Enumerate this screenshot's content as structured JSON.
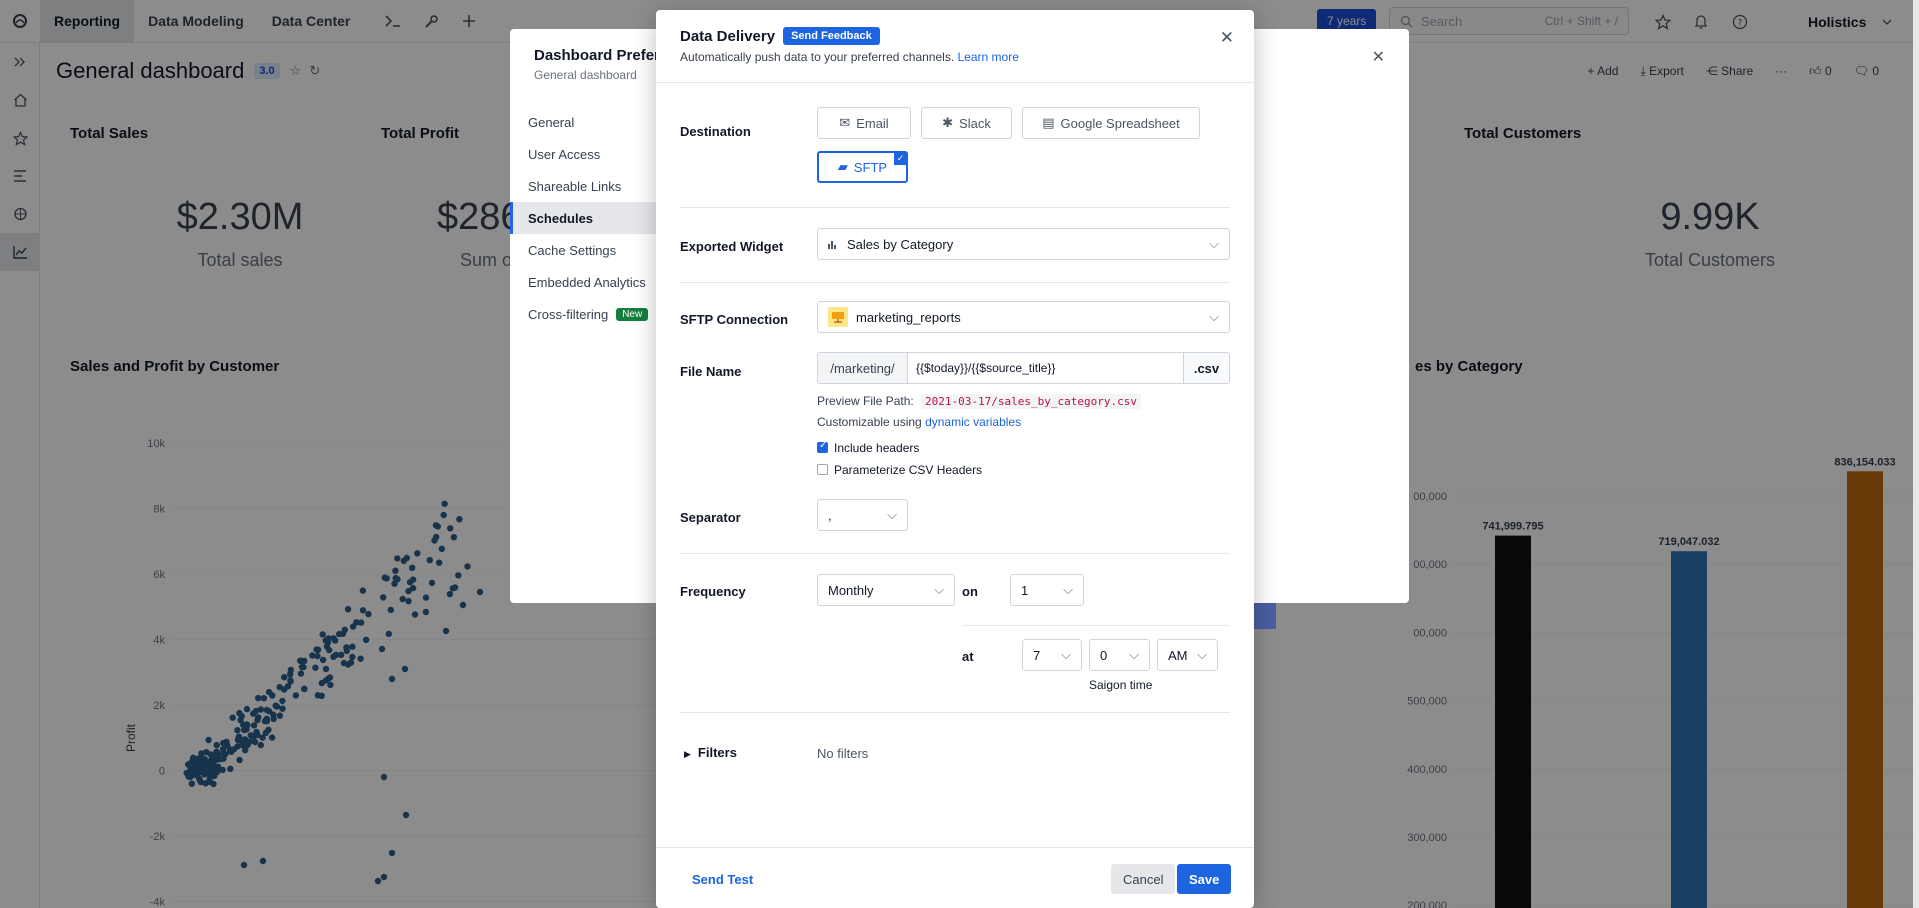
{
  "topbar": {
    "tabs": [
      "Reporting",
      "Data Modeling",
      "Data Center"
    ],
    "range": "7 years",
    "search_placeholder": "Search",
    "search_shortcut": "Ctrl + Shift + /",
    "brand": "Holistics"
  },
  "dashboard": {
    "title": "General dashboard",
    "version": "3.0",
    "actions": {
      "add": "Add",
      "export": "Export",
      "share": "Share",
      "likes": "0",
      "comments": "0"
    },
    "kpis": [
      {
        "title": "Total Sales",
        "value": "$2.30M",
        "sub": "Total sales"
      },
      {
        "title": "Total Profit",
        "value": "$286",
        "sub": "Sum o"
      },
      {
        "title": "Total Customers",
        "value": "9.99K",
        "sub": "Total Customers"
      }
    ],
    "scatter": {
      "title": "Sales and Profit by Customer",
      "ylabel": "Profit",
      "yticks": [
        "10k",
        "8k",
        "6k",
        "4k",
        "2k",
        "0",
        "-2k",
        "-4k"
      ]
    },
    "bars": {
      "title": "es by Category",
      "yticks": [
        "00,000",
        "00,000",
        "00,000",
        "500,000",
        "400,000",
        "300,000",
        "200,000"
      ],
      "labels": [
        "741,999.795",
        "719,047.032",
        "836,154.033"
      ]
    }
  },
  "chart_data": {
    "type": "bar",
    "title": "es by Category",
    "categories": [
      "",
      "",
      ""
    ],
    "values": [
      741999.795,
      719047.032,
      836154.033
    ],
    "ylim": [
      100000,
      900000
    ],
    "colors": [
      "#111111",
      "#2f74b5",
      "#c06a10"
    ]
  },
  "preferences": {
    "title": "Dashboard Prefere",
    "subtitle": "General dashboard",
    "items": [
      "General",
      "User Access",
      "Shareable Links",
      "Schedules",
      "Cache Settings",
      "Embedded Analytics",
      "Cross-filtering"
    ],
    "active_index": 3,
    "new_tag": "New"
  },
  "modal": {
    "title": "Data Delivery",
    "feedback": "Send Feedback",
    "subtitle": "Automatically push data to your preferred channels.",
    "learn_more": "Learn more",
    "destination_label": "Destination",
    "destinations": [
      "Email",
      "Slack",
      "Google Spreadsheet",
      "SFTP"
    ],
    "exported_widget_label": "Exported Widget",
    "exported_widget": "Sales by Category",
    "sftp_label": "SFTP Connection",
    "sftp_connection": "marketing_reports",
    "filename_label": "File Name",
    "filename_prefix": "/marketing/",
    "filename_value": "{{$today}}/{{$source_title}}",
    "filename_ext": ".csv",
    "preview_label": "Preview File Path:",
    "preview_path": "2021-03-17/sales_by_category.csv",
    "customizable": "Customizable using",
    "dynamic_vars": "dynamic variables",
    "include_headers": "Include headers",
    "parameterize": "Parameterize CSV Headers",
    "separator_label": "Separator",
    "separator": ",",
    "frequency_label": "Frequency",
    "frequency": "Monthly",
    "on_label": "on",
    "on_value": "1",
    "at_label": "at",
    "hour": "7",
    "minute": "0",
    "ampm": "AM",
    "timezone": "Saigon time",
    "filters_label": "Filters",
    "filters_value": "No filters",
    "send_test": "Send Test",
    "cancel": "Cancel",
    "save": "Save"
  }
}
